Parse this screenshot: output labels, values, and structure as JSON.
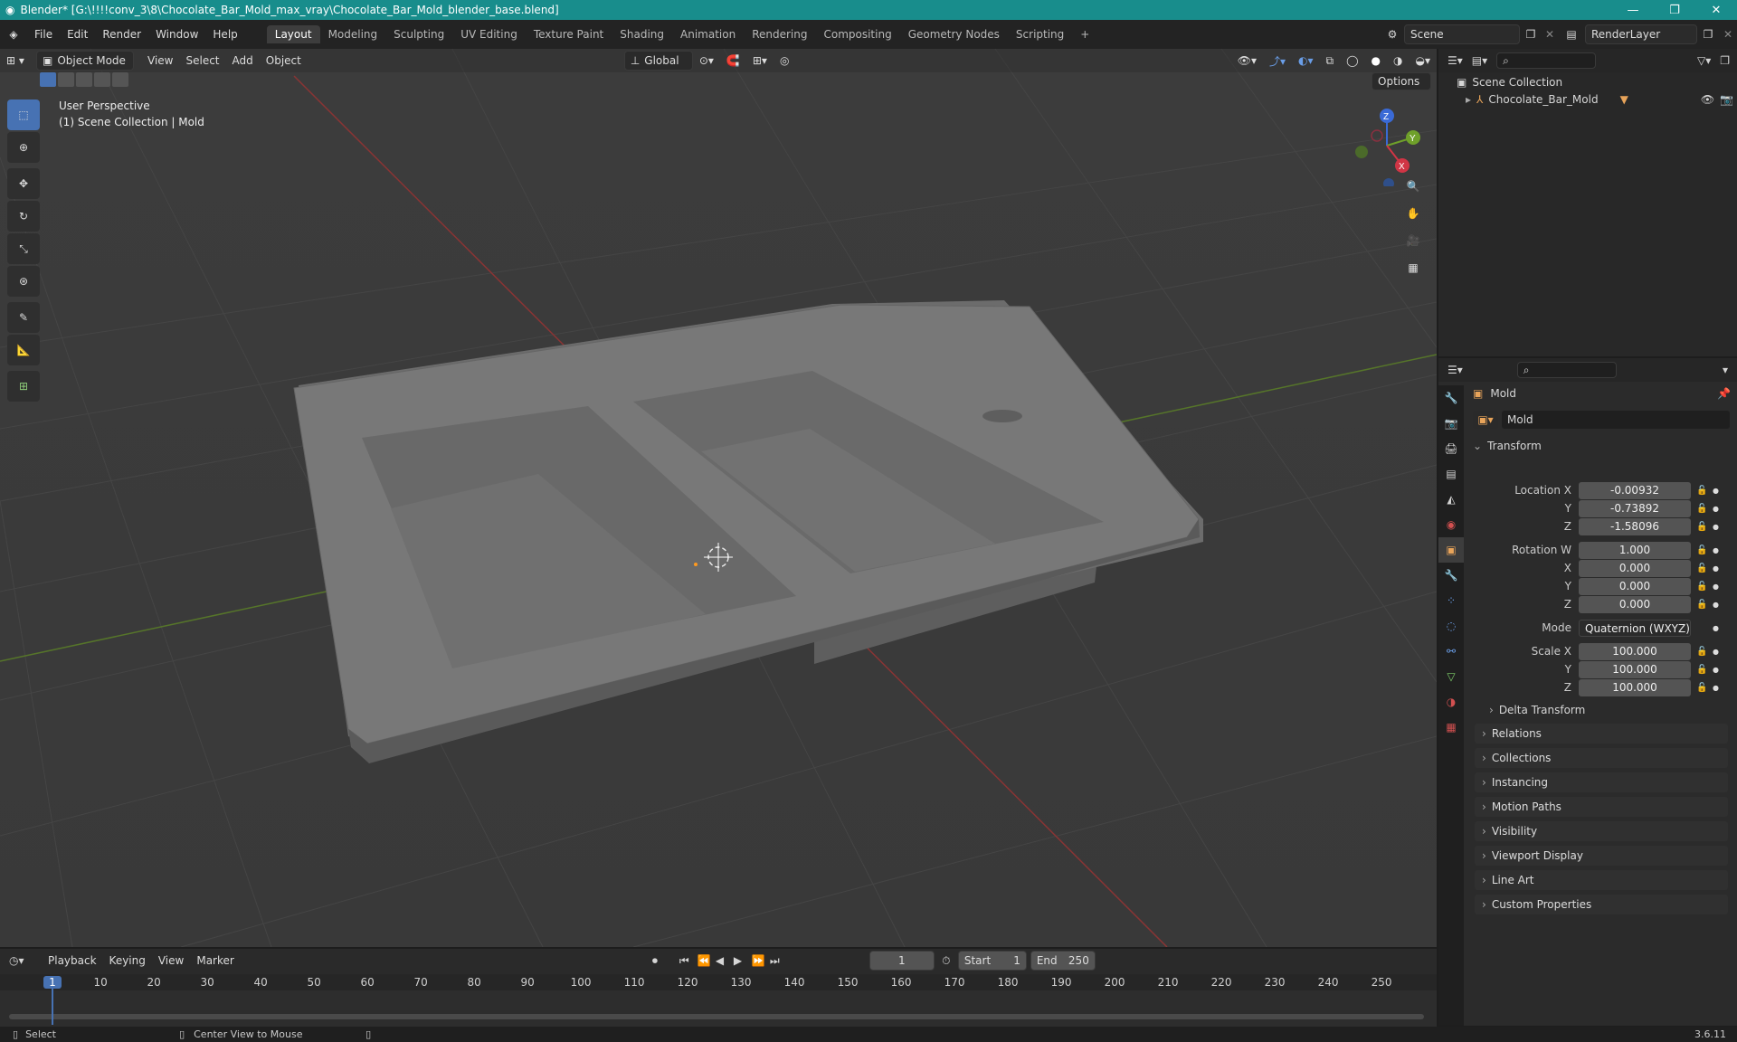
{
  "window": {
    "title": "Blender* [G:\\!!!!conv_3\\8\\Chocolate_Bar_Mold_max_vray\\Chocolate_Bar_Mold_blender_base.blend]",
    "minimize": "—",
    "maximize": "❐",
    "close": "✕"
  },
  "menu": [
    "File",
    "Edit",
    "Render",
    "Window",
    "Help"
  ],
  "workspaces": [
    "Layout",
    "Modeling",
    "Sculpting",
    "UV Editing",
    "Texture Paint",
    "Shading",
    "Animation",
    "Rendering",
    "Compositing",
    "Geometry Nodes",
    "Scripting"
  ],
  "add_workspace": "+",
  "scene": {
    "name": "Scene",
    "render_layer": "RenderLayer"
  },
  "viewport": {
    "mode": "Object Mode",
    "menus": [
      "View",
      "Select",
      "Add",
      "Object"
    ],
    "orientation": "Global",
    "options": "Options",
    "info_line1": "User Perspective",
    "info_line2": "(1) Scene Collection | Mold",
    "gizmo": {
      "x": "X",
      "y": "Y",
      "z": "Z"
    }
  },
  "outliner": {
    "root": "Scene Collection",
    "items": [
      {
        "name": "Chocolate_Bar_Mold"
      }
    ]
  },
  "properties": {
    "object_name": "Mold",
    "data_name": "Mold",
    "transform_label": "Transform",
    "location": {
      "label": "Location X",
      "x": "-0.00932",
      "y": "-0.73892",
      "z": "-1.58096"
    },
    "rotation": {
      "label": "Rotation W",
      "w": "1.000",
      "x": "0.000",
      "y": "0.000",
      "z": "0.000"
    },
    "mode": {
      "label": "Mode",
      "value": "Quaternion (WXYZ)"
    },
    "scale": {
      "label": "Scale X",
      "x": "100.000",
      "y": "100.000",
      "z": "100.000"
    },
    "axis_labels": {
      "x": "X",
      "y": "Y",
      "z": "Z"
    },
    "delta_transform": "Delta Transform",
    "panels": [
      "Relations",
      "Collections",
      "Instancing",
      "Motion Paths",
      "Visibility",
      "Viewport Display",
      "Line Art",
      "Custom Properties"
    ]
  },
  "timeline": {
    "menus": [
      "Playback",
      "Keying",
      "View",
      "Marker"
    ],
    "current_frame": "1",
    "start_label": "Start",
    "start": "1",
    "end_label": "End",
    "end": "250",
    "ruler": [
      "1",
      "10",
      "20",
      "30",
      "40",
      "50",
      "60",
      "70",
      "80",
      "90",
      "100",
      "110",
      "120",
      "130",
      "140",
      "150",
      "160",
      "170",
      "180",
      "190",
      "200",
      "210",
      "220",
      "230",
      "240",
      "250"
    ]
  },
  "status": {
    "select": "Select",
    "center": "Center View to Mouse",
    "version": "3.6.11"
  }
}
